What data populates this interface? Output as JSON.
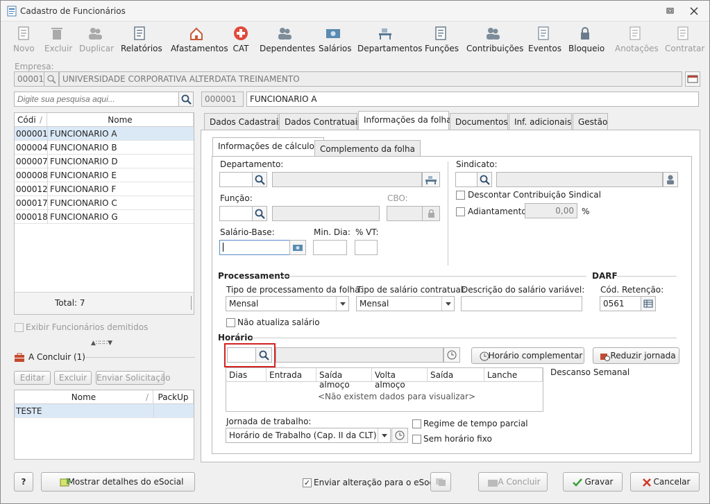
{
  "window": {
    "title": "Cadastro de Funcionários"
  },
  "toolbar": [
    {
      "id": "novo",
      "label": "Novo",
      "enabled": false,
      "icon": "new-document-icon"
    },
    {
      "id": "excluir",
      "label": "Excluir",
      "enabled": false,
      "icon": "trash-icon"
    },
    {
      "id": "duplicar",
      "label": "Duplicar",
      "enabled": false,
      "icon": "duplicate-users-icon"
    },
    {
      "id": "relatorios",
      "label": "Relatórios",
      "enabled": true,
      "icon": "report-icon"
    },
    {
      "id": "afastamentos",
      "label": "Afastamentos",
      "enabled": true,
      "icon": "house-arrow-icon"
    },
    {
      "id": "cat",
      "label": "CAT",
      "enabled": true,
      "icon": "medical-cross-icon"
    },
    {
      "id": "dependentes",
      "label": "Dependentes",
      "enabled": true,
      "icon": "users-icon"
    },
    {
      "id": "salarios",
      "label": "Salários",
      "enabled": true,
      "icon": "money-icon"
    },
    {
      "id": "departamentos",
      "label": "Departamentos",
      "enabled": true,
      "icon": "desk-icon"
    },
    {
      "id": "funcoes",
      "label": "Funções",
      "enabled": true,
      "icon": "badge-icon"
    },
    {
      "id": "contribuicoes",
      "label": "Contribuições",
      "enabled": true,
      "icon": "person-group-icon"
    },
    {
      "id": "eventos",
      "label": "Eventos",
      "enabled": true,
      "icon": "list-icon"
    },
    {
      "id": "bloqueio",
      "label": "Bloqueio",
      "enabled": true,
      "icon": "lock-icon"
    },
    {
      "id": "anotacoes",
      "label": "Anotações",
      "enabled": false,
      "icon": "note-pen-icon"
    },
    {
      "id": "contratar",
      "label": "Contratar",
      "enabled": false,
      "icon": "contract-check-icon"
    }
  ],
  "empresa": {
    "label": "Empresa:",
    "code": "00001",
    "name": "UNIVERSIDADE CORPORATIVA ALTERDATA TREINAMENTO"
  },
  "search": {
    "placeholder": "Digite sua pesquisa aqui..."
  },
  "current": {
    "code": "000001",
    "name": "FUNCIONARIO A"
  },
  "employee_grid": {
    "col_code": "Códi",
    "col_name": "Nome",
    "rows": [
      {
        "code": "000001",
        "name": "FUNCIONARIO A"
      },
      {
        "code": "000004",
        "name": "FUNCIONARIO B"
      },
      {
        "code": "000007",
        "name": "FUNCIONARIO D"
      },
      {
        "code": "000008",
        "name": "FUNCIONARIO E"
      },
      {
        "code": "000012",
        "name": "FUNCIONARIO F"
      },
      {
        "code": "000017",
        "name": "FUNCIONARIO C"
      },
      {
        "code": "000018",
        "name": "FUNCIONARIO G"
      }
    ],
    "total": "Total: 7"
  },
  "show_dismissed": "Exibir Funcionários demitidos",
  "a_concluir": {
    "title": "A Concluir (1)",
    "edit": "Editar",
    "delete": "Excluir",
    "send": "Enviar Solicitação",
    "col_name": "Nome",
    "col_packup": "PackUp",
    "rows": [
      "TESTE"
    ]
  },
  "tabs": [
    "Dados Cadastrais",
    "Dados Contratuais",
    "Informações da folha",
    "Documentos",
    "Inf. adicionais",
    "Gestão"
  ],
  "subtabs": [
    "Informações de cálculos",
    "Complemento da folha"
  ],
  "calc": {
    "departamento": "Departamento:",
    "funcao": "Função:",
    "cbo": "CBO:",
    "salario_base": "Salário-Base:",
    "min_dia": "Min. Dia:",
    "vt": "% VT:",
    "sindicato": "Sindicato:",
    "descontar": "Descontar Contribuição Sindical",
    "adiantamento": "Adiantamento",
    "adiantamento_value": "0,00",
    "percent": "%"
  },
  "processamento": {
    "title": "Processamento",
    "darf": "DARF",
    "tipo_proc_label": "Tipo de processamento da folha:",
    "tipo_proc_value": "Mensal",
    "tipo_sal_label": "Tipo de salário contratual:",
    "tipo_sal_value": "Mensal",
    "desc_var_label": "Descrição do salário variável:",
    "cod_ret_label": "Cód. Retenção:",
    "cod_ret_value": "0561",
    "nao_atualiza": "Não atualiza salário"
  },
  "horario": {
    "title": "Horário",
    "complementar": "Horário complementar",
    "reduzir": "Reduzir jornada",
    "descanso": "Descanso Semanal",
    "cols": [
      "Dias",
      "Entrada",
      "Saída almoço",
      "Volta almoço",
      "Saída",
      "Lanche"
    ],
    "empty": "<Não existem dados para visualizar>",
    "jornada_label": "Jornada de trabalho:",
    "jornada_value": "Horário de Trabalho (Cap. II da CLT)",
    "regime": "Regime de tempo parcial",
    "sem_horario": "Sem horário fixo"
  },
  "footer": {
    "help": "?",
    "esocial_details": "Mostrar detalhes do eSocial",
    "enviar": "Enviar alteração para o eSocial",
    "a_concluir": "A Concluir",
    "gravar": "Gravar",
    "cancelar": "Cancelar"
  }
}
